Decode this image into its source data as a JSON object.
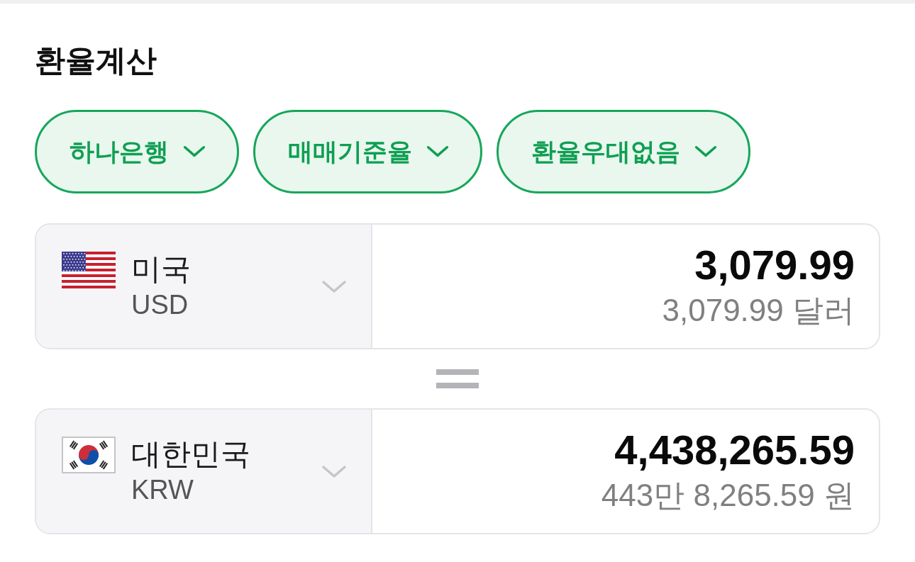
{
  "title": "환율계산",
  "filters": [
    {
      "label": "하나은행"
    },
    {
      "label": "매매기준율"
    },
    {
      "label": "환율우대없음"
    }
  ],
  "currencies": [
    {
      "kind": "usa",
      "country": "미국",
      "code": "USD",
      "amount": "3,079.99",
      "amount_words": "3,079.99 달러"
    },
    {
      "kind": "korea",
      "country": "대한민국",
      "code": "KRW",
      "amount": "4,438,265.59",
      "amount_words": "443만 8,265.59 원"
    }
  ]
}
